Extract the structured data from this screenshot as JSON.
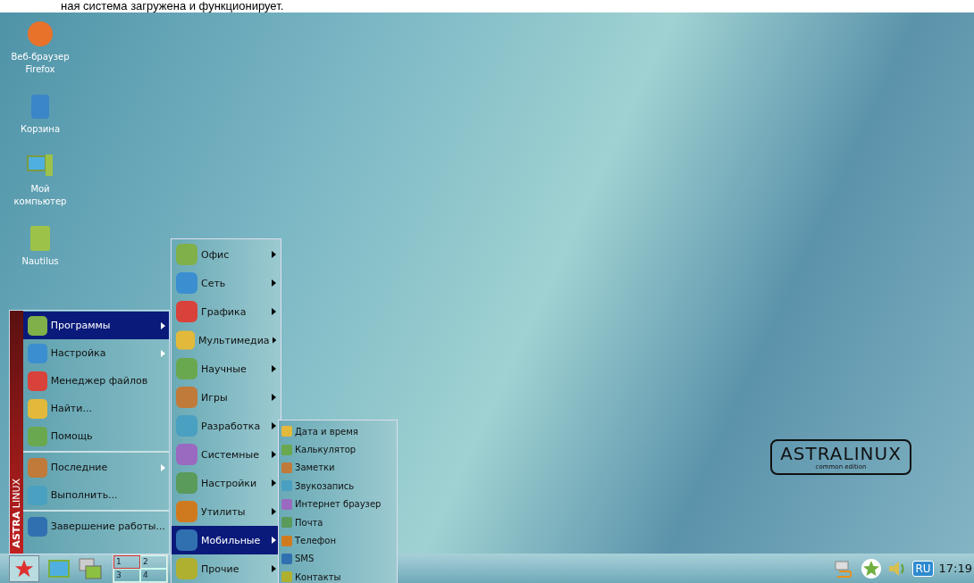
{
  "caption": "ная система загружена и функционирует.",
  "desktop_icons": [
    {
      "label": "Веб-браузер Firefox",
      "kind": "browser"
    },
    {
      "label": "Корзина",
      "kind": "trash"
    },
    {
      "label": "Мой компьютер",
      "kind": "computer"
    },
    {
      "label": "Nautilus",
      "kind": "cabinet"
    }
  ],
  "start_menu": {
    "brand": "**ASTRA** LINUX",
    "groups": [
      [
        {
          "label": "Программы",
          "selected": true,
          "has_submenu": true
        },
        {
          "label": "Настройка",
          "selected": false,
          "has_submenu": true
        },
        {
          "label": "Менеджер файлов",
          "selected": false,
          "has_submenu": false
        },
        {
          "label": "Найти...",
          "selected": false,
          "has_submenu": false
        },
        {
          "label": "Помощь",
          "selected": false,
          "has_submenu": false
        }
      ],
      [
        {
          "label": "Последние",
          "selected": false,
          "has_submenu": true
        },
        {
          "label": "Выполнить...",
          "selected": false,
          "has_submenu": false
        }
      ],
      [
        {
          "label": "Завершение работы...",
          "selected": false,
          "has_submenu": false
        }
      ]
    ]
  },
  "programs_menu": [
    {
      "label": "Офис",
      "selected": false
    },
    {
      "label": "Сеть",
      "selected": false
    },
    {
      "label": "Графика",
      "selected": false
    },
    {
      "label": "Мультимедиа",
      "selected": false
    },
    {
      "label": "Научные",
      "selected": false
    },
    {
      "label": "Игры",
      "selected": false
    },
    {
      "label": "Разработка",
      "selected": false
    },
    {
      "label": "Системные",
      "selected": false
    },
    {
      "label": "Настройки",
      "selected": false
    },
    {
      "label": "Утилиты",
      "selected": false
    },
    {
      "label": "Мобильные",
      "selected": true
    },
    {
      "label": "Прочие",
      "selected": false
    }
  ],
  "mobile_menu": [
    "Дата и время",
    "Калькулятор",
    "Заметки",
    "Звукозапись",
    "Интернет браузер",
    "Почта",
    "Телефон",
    "SMS",
    "Контакты"
  ],
  "logo": {
    "name": "ASTRALINUX",
    "edition": "common edition"
  },
  "taskbar": {
    "pager": [
      {
        "label": "1",
        "selected": true
      },
      {
        "label": "2",
        "selected": false
      },
      {
        "label": "3",
        "selected": false
      },
      {
        "label": "4",
        "selected": false
      }
    ],
    "language": "RU",
    "clock": "17:19"
  }
}
